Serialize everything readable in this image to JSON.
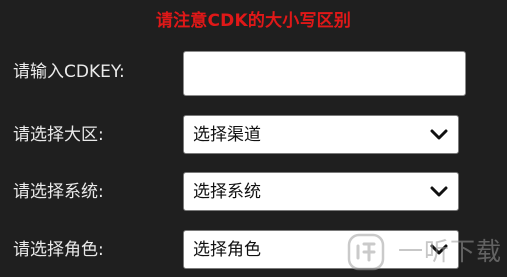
{
  "notice": "请注意CDK的大小写区别",
  "form": {
    "cdkey": {
      "label": "请输入CDKEY:",
      "value": "",
      "placeholder": ""
    },
    "region": {
      "label": "请选择大区:",
      "selected": "选择渠道"
    },
    "system": {
      "label": "请选择系统:",
      "selected": "选择系统"
    },
    "role": {
      "label": "请选择角色:",
      "selected": "选择角色"
    }
  },
  "icons": {
    "select_arrow": "chevron-down-icon",
    "watermark_logo": "yiting-logo-icon"
  },
  "watermark": {
    "text": "一听下载"
  },
  "colors": {
    "background": "#1f1f1f",
    "notice": "#e01818",
    "label": "#eaeaea",
    "field_background": "#ffffff"
  }
}
